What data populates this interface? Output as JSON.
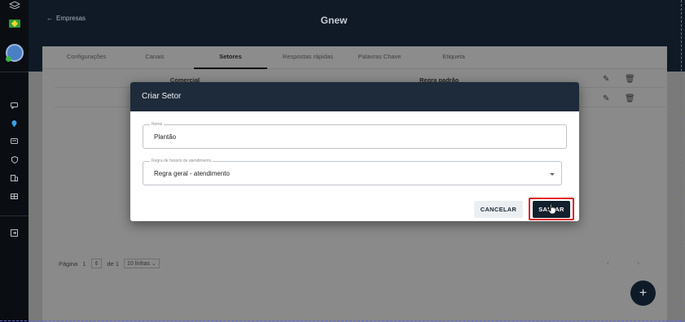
{
  "header": {
    "back_label": "Empresas",
    "title": "Gnew"
  },
  "tabs": [
    {
      "label": "Configurações"
    },
    {
      "label": "Canais"
    },
    {
      "label": "Setores"
    },
    {
      "label": "Respostas rápidas"
    },
    {
      "label": "Palavras Chave"
    },
    {
      "label": "Etiqueta"
    }
  ],
  "active_tab": "Setores",
  "table": {
    "rows": [
      {
        "name": "Comercial",
        "schedule_rule": "Regra padrão"
      },
      {
        "name": "",
        "schedule_rule": ""
      }
    ]
  },
  "pagination": {
    "page_label": "Página",
    "page_number": "1",
    "of_label": "de 1",
    "rows_per_page": "10 linhas"
  },
  "modal": {
    "title": "Criar Setor",
    "name_field": {
      "label": "Nome",
      "value": "Plantão"
    },
    "rule_field": {
      "label": "Regra de horário de atendimento",
      "value": "Regra geral - atendimento"
    },
    "cancel_label": "CANCELAR",
    "save_label": "SALVAR"
  },
  "fab_label": "+",
  "colors": {
    "header_bg": "#0f1a26",
    "modal_header_bg": "#1d2b3a",
    "save_button_bg": "#13202d",
    "highlight_outline": "#e01b24"
  }
}
